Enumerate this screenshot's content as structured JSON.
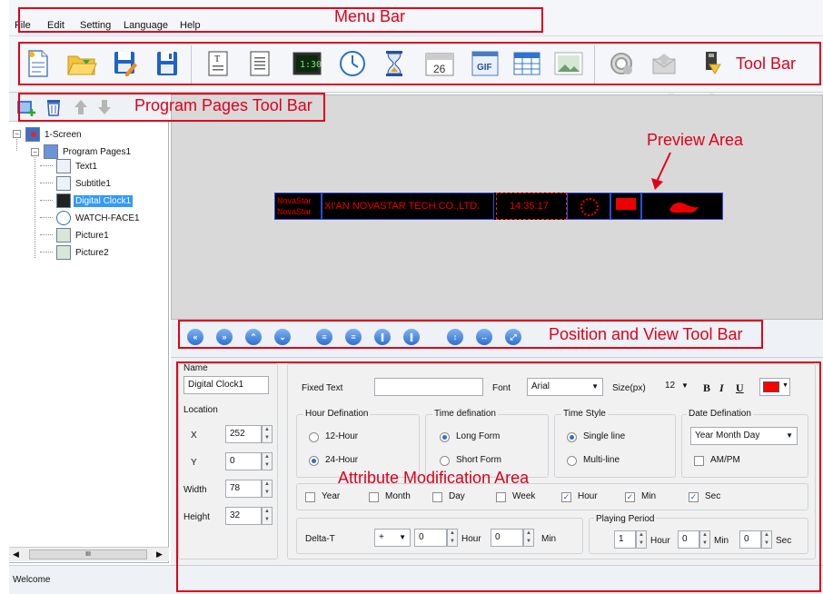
{
  "menu": [
    "File",
    "Edit",
    "Setting",
    "Language",
    "Help"
  ],
  "toolbar": {
    "icons": [
      "new-file-icon",
      "open-folder-icon",
      "save-edit-icon",
      "save-icon",
      "text-icon",
      "subtitle-icon",
      "digital-clock-icon",
      "watch-face-icon",
      "timer-icon",
      "calendar-icon",
      "gif-icon",
      "table-icon",
      "picture-icon",
      "settings-icon",
      "send-icon",
      "export-usb-icon"
    ],
    "clock_text": "1:30",
    "calendar_text": "26",
    "gif_text": "GIF"
  },
  "program_pages_toolbar": {
    "icons": [
      "add-page-icon",
      "delete-icon",
      "up-arrow-icon",
      "down-arrow-icon"
    ]
  },
  "tree": {
    "screen": "1-Screen",
    "program": "Program Pages1",
    "items": [
      "Text1",
      "Subtitle1",
      "Digital Clock1",
      "WATCH-FACE1",
      "Picture1",
      "Picture2"
    ],
    "selected": "Digital Clock1",
    "scroll_mark": "III"
  },
  "preview": {
    "led_text_1": "NovaStar",
    "led_text_2": "NovaStar",
    "marquee": "XI'AN NOVASTAR TECH.CO.,LTD.",
    "clock": "14:35:17"
  },
  "attributes": {
    "name_label": "Name",
    "name_value": "Digital Clock1",
    "location_label": "Location",
    "x_label": "X",
    "x_value": "252",
    "y_label": "Y",
    "y_value": "0",
    "width_label": "Width",
    "width_value": "78",
    "height_label": "Height",
    "height_value": "32",
    "fixed_text_label": "Fixed Text",
    "fixed_text_value": "",
    "font_label": "Font",
    "font_value": "Arial",
    "size_label": "Size(px)",
    "size_value": "12",
    "bold": "B",
    "italic": "I",
    "underline": "U",
    "text_color": "#ff0000",
    "hour_def_title": "Hour Defination",
    "hour_12": "12-Hour",
    "hour_24": "24-Hour",
    "hour_selected": "24-Hour",
    "time_def_title": "Time defination",
    "long_form": "Long Form",
    "short_form": "Short Form",
    "time_def_selected": "Long Form",
    "time_style_title": "Time Style",
    "single_line": "Single line",
    "multi_line": "Multi-line",
    "time_style_selected": "Single line",
    "date_def_title": "Date Defination",
    "date_def_value": "Year Month Day",
    "ampm_label": "AM/PM",
    "ampm_checked": false,
    "checks": [
      {
        "label": "Year",
        "checked": false
      },
      {
        "label": "Month",
        "checked": false
      },
      {
        "label": "Day",
        "checked": false
      },
      {
        "label": "Week",
        "checked": false
      },
      {
        "label": "Hour",
        "checked": true
      },
      {
        "label": "Min",
        "checked": true
      },
      {
        "label": "Sec",
        "checked": true
      }
    ],
    "delta_label": "Delta-T",
    "delta_sign": "+",
    "delta_hour_value": "0",
    "delta_hour_unit": "Hour",
    "delta_min_value": "0",
    "delta_min_unit": "Min",
    "playing_period_title": "Playing Period",
    "pp_hour_value": "1",
    "pp_hour_unit": "Hour",
    "pp_min_value": "0",
    "pp_min_unit": "Min",
    "pp_sec_value": "0",
    "pp_sec_unit": "Sec"
  },
  "status": "Welcome",
  "annotations": {
    "menu_bar": "Menu Bar",
    "tool_bar": "Tool Bar",
    "program_pages_tool_bar": "Program Pages Tool Bar",
    "preview_area": "Preview Area",
    "position_view_tool_bar": "Position and View Tool Bar",
    "attribute_area": "Attribute Modification Area",
    "color": "#e0001a"
  },
  "watermark": "TECH CO., L"
}
